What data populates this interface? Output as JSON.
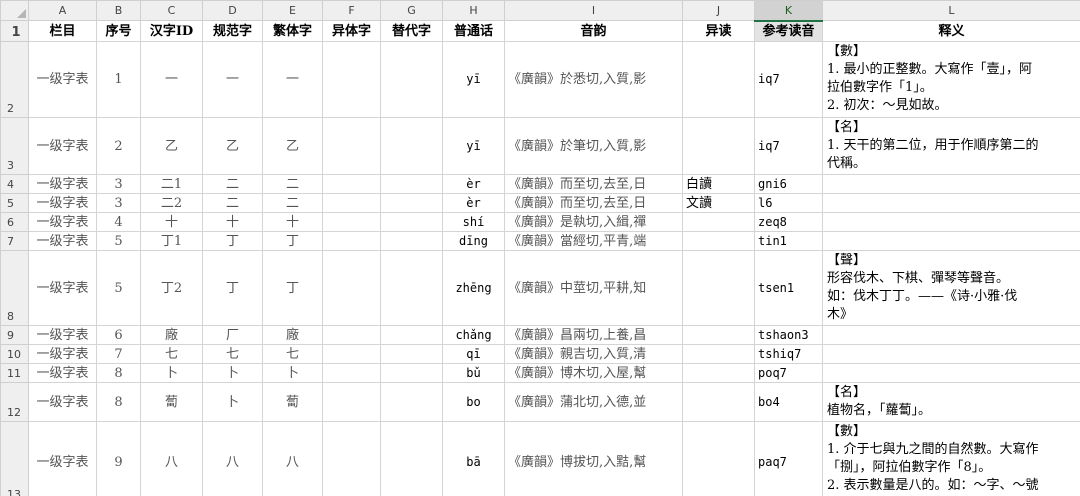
{
  "columns": [
    "A",
    "B",
    "C",
    "D",
    "E",
    "F",
    "G",
    "H",
    "I",
    "J",
    "K",
    "L"
  ],
  "headers": [
    "栏目",
    "序号",
    "汉字ID",
    "规范字",
    "繁体字",
    "异体字",
    "替代字",
    "普通话",
    "音韵",
    "异读",
    "参考读音",
    "释义"
  ],
  "rows": [
    {
      "num": "2",
      "cat": "一级字表",
      "idx": "1",
      "hid": "一",
      "std": "一",
      "trad": "一",
      "pth": "yī",
      "yun": "《廣韻》於悉切,入質,影",
      "yidu": "",
      "ref": "iq7",
      "notes": [
        "【數】",
        "1. 最小的正整數。大寫作「壹」，阿",
        "拉伯數字作「1」。",
        "2. 初次：～見如故。"
      ]
    },
    {
      "num": "3",
      "cat": "一级字表",
      "idx": "2",
      "hid": "乙",
      "std": "乙",
      "trad": "乙",
      "pth": "yī",
      "yun": "《廣韻》於筆切,入質,影",
      "yidu": "",
      "ref": "iq7",
      "notes": [
        "【名】",
        "1. 天干的第二位，用于作順序第二的",
        "代稱。"
      ]
    },
    {
      "num": "4",
      "cat": "一级字表",
      "idx": "3",
      "hid": "二1",
      "std": "二",
      "trad": "二",
      "pth": "èr",
      "yun": "《廣韻》而至切,去至,日",
      "yidu": "白讀",
      "ref": "gni6",
      "notes": []
    },
    {
      "num": "5",
      "cat": "一级字表",
      "idx": "3",
      "hid": "二2",
      "std": "二",
      "trad": "二",
      "pth": "èr",
      "yun": "《廣韻》而至切,去至,日",
      "yidu": "文讀",
      "ref": "l6",
      "notes": []
    },
    {
      "num": "6",
      "cat": "一级字表",
      "idx": "4",
      "hid": "十",
      "std": "十",
      "trad": "十",
      "pth": "shí",
      "yun": "《廣韻》是執切,入緝,禪",
      "yidu": "",
      "ref": "zeq8",
      "notes": []
    },
    {
      "num": "7",
      "cat": "一级字表",
      "idx": "5",
      "hid": "丁1",
      "std": "丁",
      "trad": "丁",
      "pth": "dīng",
      "yun": "《廣韻》當經切,平青,端",
      "yidu": "",
      "ref": "tin1",
      "notes": []
    },
    {
      "num": "8",
      "cat": "一级字表",
      "idx": "5",
      "hid": "丁2",
      "std": "丁",
      "trad": "丁",
      "pth": "zhēng",
      "yun": "《廣韻》中莖切,平耕,知",
      "yidu": "",
      "ref": "tsen1",
      "notes": [
        "【聲】",
        "形容伐木、下棋、彈琴等聲音。",
        "如：伐木丁丁。——《诗·小雅·伐",
        "木》"
      ]
    },
    {
      "num": "9",
      "cat": "一级字表",
      "idx": "6",
      "hid": "廠",
      "std": "厂",
      "trad": "廠",
      "pth": "chǎng",
      "yun": "《廣韻》昌兩切,上養,昌",
      "yidu": "",
      "ref": "tshaon3",
      "notes": []
    },
    {
      "num": "10",
      "cat": "一级字表",
      "idx": "7",
      "hid": "七",
      "std": "七",
      "trad": "七",
      "pth": "qī",
      "yun": "《廣韻》親吉切,入質,清",
      "yidu": "",
      "ref": "tshiq7",
      "notes": []
    },
    {
      "num": "11",
      "cat": "一级字表",
      "idx": "8",
      "hid": "卜",
      "std": "卜",
      "trad": "卜",
      "pth": "bǔ",
      "yun": "《廣韻》博木切,入屋,幫",
      "yidu": "",
      "ref": "poq7",
      "notes": []
    },
    {
      "num": "12",
      "cat": "一级字表",
      "idx": "8",
      "hid": "蔔",
      "std": "卜",
      "trad": "蔔",
      "pth": "bo",
      "yun": "《廣韻》蒲北切,入德,並",
      "yidu": "",
      "ref": "bo4",
      "notes": [
        "【名】",
        "植物名，「蘿蔔」。"
      ]
    },
    {
      "num": "13",
      "cat": "一级字表",
      "idx": "9",
      "hid": "八",
      "std": "八",
      "trad": "八",
      "pth": "bā",
      "yun": "《廣韻》博拔切,入黠,幫",
      "yidu": "",
      "ref": "paq7",
      "notes": [
        "【數】",
        "1. 介于七與九之間的自然數。大寫作",
        "「捌」，阿拉伯數字作「8」。",
        "2. 表示數量是八的。如：～字、～號"
      ]
    }
  ]
}
